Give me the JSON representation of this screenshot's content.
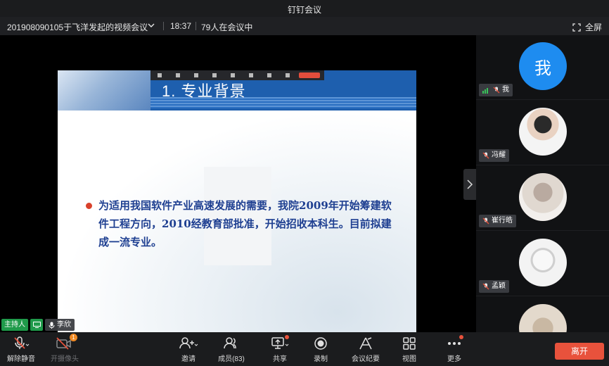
{
  "window": {
    "title": "钉钉会议"
  },
  "meeting": {
    "name": "201908090105于飞洋发起的视频会议",
    "time": "18:37",
    "participants_text": "79人在会议中",
    "fullscreen_label": "全屏"
  },
  "slide": {
    "title": "1. 专业背景",
    "body": "为适用我国软件产业高速发展的需要，我院2009年开始筹建软件工程方向，2010经教育部批准，开始招收本科生。目前拟建成一流专业。"
  },
  "participants": [
    {
      "name": "我",
      "avatar_text": "我",
      "avatar_color": "#1e8cf0"
    },
    {
      "name": "冯耀"
    },
    {
      "name": "崔行皓"
    },
    {
      "name": "孟颖"
    }
  ],
  "speaker": {
    "host_label": "主持人",
    "name": "李欣"
  },
  "toolbar": {
    "unmute": "解除静音",
    "camera": "开摄像头",
    "camera_badge": "1",
    "invite": "邀请",
    "members": "成员(83)",
    "share": "共享",
    "record": "录制",
    "minutes": "会议纪要",
    "view": "视图",
    "more": "更多",
    "leave": "离开"
  },
  "colors": {
    "accent": "#1e8cf0",
    "leave": "#e8523c",
    "host": "#1f9a4a",
    "slide_text": "#1e3f91"
  }
}
